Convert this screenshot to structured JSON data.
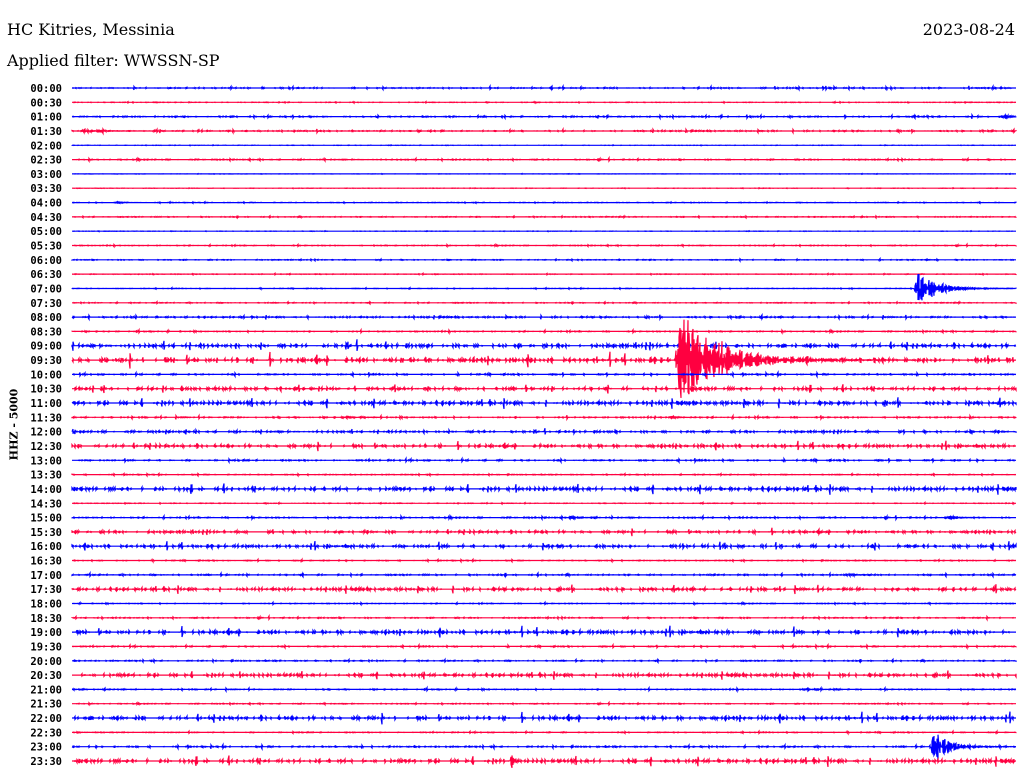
{
  "header": {
    "station": "HC Kitries, Messinia",
    "date": "2023-08-24",
    "filter": "Applied filter: WWSSN-SP"
  },
  "chart_data": {
    "type": "line",
    "subtype": "helicorder",
    "channel_label": "HHZ - 5000",
    "minutes_per_row": 30,
    "colors": [
      "#0000ff",
      "#ff0040"
    ],
    "rows": [
      "00:00",
      "00:30",
      "01:00",
      "01:30",
      "02:00",
      "02:30",
      "03:00",
      "03:30",
      "04:00",
      "04:30",
      "05:00",
      "05:30",
      "06:00",
      "06:30",
      "07:00",
      "07:30",
      "08:00",
      "08:30",
      "09:00",
      "09:30",
      "10:00",
      "10:30",
      "11:00",
      "11:30",
      "12:00",
      "12:30",
      "13:00",
      "13:30",
      "14:00",
      "14:30",
      "15:00",
      "15:30",
      "16:00",
      "16:30",
      "17:00",
      "17:30",
      "18:00",
      "18:30",
      "19:00",
      "19:30",
      "20:00",
      "20:30",
      "21:00",
      "21:30",
      "22:00",
      "22:30",
      "23:00",
      "23:30"
    ],
    "noise": [
      0.05,
      0.02,
      0.05,
      0.05,
      0.01,
      0.04,
      0.01,
      0.01,
      0.02,
      0.03,
      0.01,
      0.03,
      0.03,
      0.02,
      0.02,
      0.03,
      0.06,
      0.04,
      0.15,
      0.2,
      0.05,
      0.12,
      0.15,
      0.05,
      0.08,
      0.12,
      0.05,
      0.03,
      0.15,
      0.02,
      0.05,
      0.1,
      0.12,
      0.03,
      0.05,
      0.12,
      0.03,
      0.04,
      0.15,
      0.04,
      0.04,
      0.12,
      0.04,
      0.03,
      0.15,
      0.03,
      0.05,
      0.15
    ],
    "events": [
      {
        "row": "09:30",
        "minute": 19.2,
        "amp": 3.5,
        "duration": 2.5
      },
      {
        "row": "07:00",
        "minute": 26.8,
        "amp": 1.2,
        "duration": 1.2
      },
      {
        "row": "23:00",
        "minute": 27.3,
        "amp": 1.3,
        "duration": 1.0
      },
      {
        "row": "01:30",
        "minute": 0.3,
        "amp": 0.15,
        "duration": 1.0
      },
      {
        "row": "01:00",
        "minute": 29.6,
        "amp": 0.15,
        "duration": 0.4
      },
      {
        "row": "04:00",
        "minute": 1.4,
        "amp": 0.12,
        "duration": 0.3
      },
      {
        "row": "11:30",
        "minute": 8.6,
        "amp": 0.12,
        "duration": 0.5
      },
      {
        "row": "11:30",
        "minute": 19.0,
        "amp": 0.15,
        "duration": 0.3
      },
      {
        "row": "15:00",
        "minute": 15.8,
        "amp": 0.12,
        "duration": 0.4
      },
      {
        "row": "15:00",
        "minute": 27.8,
        "amp": 0.12,
        "duration": 0.8
      },
      {
        "row": "17:00",
        "minute": 24.6,
        "amp": 0.12,
        "duration": 0.4
      },
      {
        "row": "21:00",
        "minute": 23.2,
        "amp": 0.12,
        "duration": 0.6
      },
      {
        "row": "23:30",
        "minute": 13.9,
        "amp": 0.6,
        "duration": 0.1
      }
    ]
  }
}
